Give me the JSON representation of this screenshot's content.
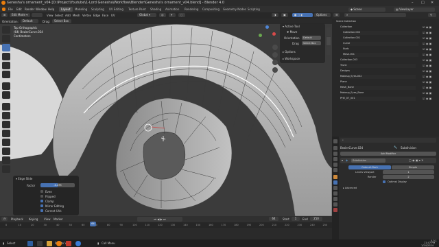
{
  "window": {
    "title": "Genesha's ornament_v04 [D:\\Project\\Youtube\\1-Lord Genesha\\Workflow\\Blender\\Genesha's ornament_v04.blend] - Blender 4.0"
  },
  "menu": [
    "File",
    "Edit",
    "Render",
    "Window",
    "Help"
  ],
  "workspaces": [
    "Layout",
    "Modeling",
    "Sculpting",
    "UV Editing",
    "Texture Paint",
    "Shading",
    "Animation",
    "Rendering",
    "Compositing",
    "Geometry Nodes",
    "Scripting"
  ],
  "active_workspace": "Layout",
  "scene": {
    "name": "Scene",
    "view_layer": "ViewLayer"
  },
  "viewport": {
    "mode": "Edit Mode",
    "menus": [
      "View",
      "Select",
      "Add",
      "Mesh",
      "Vertex",
      "Edge",
      "Face",
      "UV"
    ],
    "orientation_label": "Orientation:",
    "orientation_value": "Default",
    "drag_label": "Drag:",
    "drag_value": "Select Box",
    "transform": "Global",
    "options_label": "Options",
    "overlay": [
      "Top Orthographic",
      "(64) BezierCurve.024",
      "Centimeters"
    ]
  },
  "npanel": {
    "active_tool_label": "Active Tool",
    "tool_name": "Move",
    "orientation_label": "Orientation",
    "orientation_value": "Default",
    "drag_label": "Drag",
    "drag_value": "Select Box",
    "options_label": "Options",
    "workspace_label": "Workspace"
  },
  "edge_slide": {
    "title": "Edge Slide",
    "factor_label": "Factor",
    "factor_value": "-0.473",
    "even": "Even",
    "flipped": "Flipped",
    "clamp": "Clamp",
    "mirror": "Mirror Editing",
    "correct_uvs": "Correct UVs",
    "checks": {
      "even": false,
      "flipped": false,
      "clamp": true,
      "mirror": true,
      "correct_uvs": true
    }
  },
  "timeline": {
    "menus": [
      "Playback",
      "Keying",
      "View",
      "Marker"
    ],
    "current_frame": "64",
    "start_label": "Start",
    "start": "1",
    "end_label": "End",
    "end": "250",
    "ticks": [
      "0",
      "10",
      "20",
      "30",
      "40",
      "50",
      "60",
      "70",
      "80",
      "90",
      "100",
      "110",
      "120",
      "130",
      "140",
      "150",
      "160",
      "170",
      "180",
      "190",
      "200",
      "210",
      "220",
      "230",
      "240",
      "250"
    ]
  },
  "statusbar": {
    "hints": [
      "Select",
      "Rotate View",
      "Call Menu"
    ],
    "version": "4.0.1",
    "time": "11:47 PM",
    "date": "1/24/2024"
  },
  "outliner": {
    "title": "Scene Collection",
    "rows": [
      "Collection",
      "Collection.002",
      "Collection.001",
      "Curve",
      "Nurb",
      "Mesh.001",
      "Collection.003",
      "Trunk",
      "Designs",
      "Makeup_Eyes.002",
      "Plane",
      "Mesh_Bone",
      "Makeup_Eyes_Bone",
      "PHE_07_001"
    ]
  },
  "properties": {
    "object_name": "BezierCurve.024",
    "modifier_label": "Subdivision",
    "add_modifier": "Add Modifier",
    "catmull": "Catmull-Clark",
    "simple": "Simple",
    "levels_viewport_label": "Levels Viewport",
    "levels_viewport": "1",
    "render_label": "Render",
    "render": "2",
    "optimal_display": "Optimal Display",
    "advanced": "Advanced"
  },
  "colors": {
    "accent": "#4772b3",
    "selected_edge": "#e5a23c",
    "bg": "#3b3b3b"
  }
}
